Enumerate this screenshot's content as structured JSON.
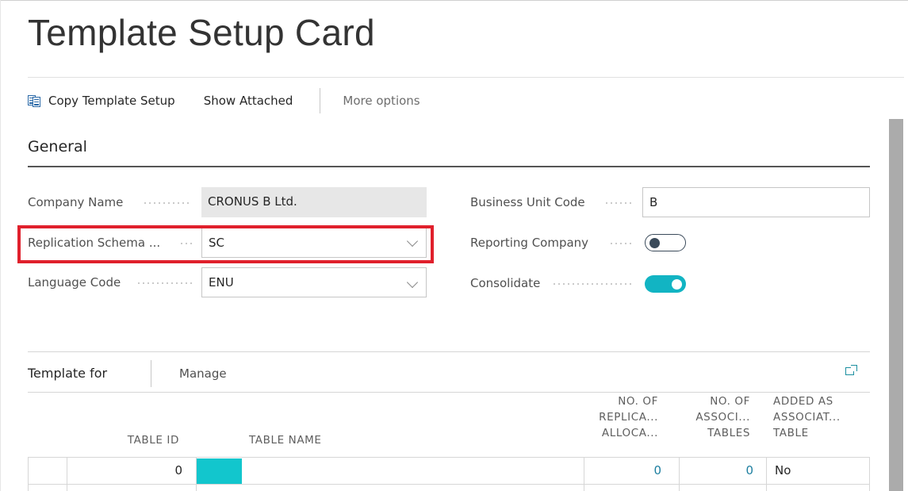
{
  "page": {
    "title": "Template Setup Card"
  },
  "actions": {
    "copy_label": "Copy Template Setup",
    "show_attached_label": "Show Attached",
    "more_options_label": "More options"
  },
  "general": {
    "title": "General",
    "company_name": {
      "label": "Company Name",
      "value": "CRONUS B Ltd."
    },
    "replication_schema": {
      "label": "Replication Schema ...",
      "value": "SC"
    },
    "language_code": {
      "label": "Language Code",
      "value": "ENU"
    },
    "business_unit_code": {
      "label": "Business Unit Code",
      "value": "B"
    },
    "reporting_company": {
      "label": "Reporting Company",
      "value": false
    },
    "consolidate": {
      "label": "Consolidate",
      "value": true
    }
  },
  "template_for": {
    "title": "Template for",
    "manage_label": "Manage",
    "columns": {
      "table_id": "TABLE ID",
      "table_name": "TABLE NAME",
      "replica_1": "NO. OF",
      "replica_2": "REPLICA...",
      "replica_3": "ALLOCA...",
      "assoc_1": "NO. OF",
      "assoc_2": "ASSOCI...",
      "assoc_3": "TABLES",
      "added_1": "ADDED AS",
      "added_2": "ASSOCIAT...",
      "added_3": "TABLE"
    },
    "rows": [
      {
        "table_id": "0",
        "table_name": "",
        "replica_alloc": "0",
        "assoc_tables": "0",
        "added_as_assoc": "No"
      }
    ]
  },
  "colors": {
    "accent": "#12b4c3",
    "highlight": "#e0202c",
    "link": "#1e7fa0"
  },
  "icons": [
    "copy-icon",
    "chevron-down-icon",
    "expand-icon"
  ]
}
